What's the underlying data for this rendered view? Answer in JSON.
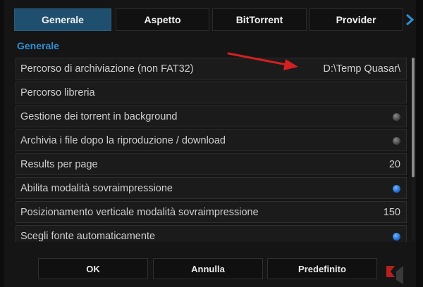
{
  "tabs": [
    {
      "label": "Generale",
      "active": true
    },
    {
      "label": "Aspetto",
      "active": false
    },
    {
      "label": "BitTorrent",
      "active": false
    },
    {
      "label": "Provider",
      "active": false
    }
  ],
  "section_title": "Generale",
  "settings": [
    {
      "label": "Percorso di archiviazione (non FAT32)",
      "value": "D:\\Temp Quasar\\"
    },
    {
      "label": "Percorso libreria",
      "value": ""
    },
    {
      "label": "Gestione dei torrent in background",
      "toggle": "off"
    },
    {
      "label": "Archivia i file dopo la riproduzione / download",
      "toggle": "off"
    },
    {
      "label": "Results per page",
      "value": "20"
    },
    {
      "label": "Abilita modalità sovraimpressione",
      "toggle": "on"
    },
    {
      "label": "Posizionamento verticale modalità sovraimpressione",
      "value": "150"
    },
    {
      "label": "Scegli fonte automaticamente",
      "toggle": "on"
    }
  ],
  "buttons": {
    "ok": "OK",
    "cancel": "Annulla",
    "default": "Predefinito"
  },
  "colors": {
    "accent": "#2d8fd6",
    "active_tab": "#1f4f6e",
    "annotation_arrow": "#d42020"
  }
}
